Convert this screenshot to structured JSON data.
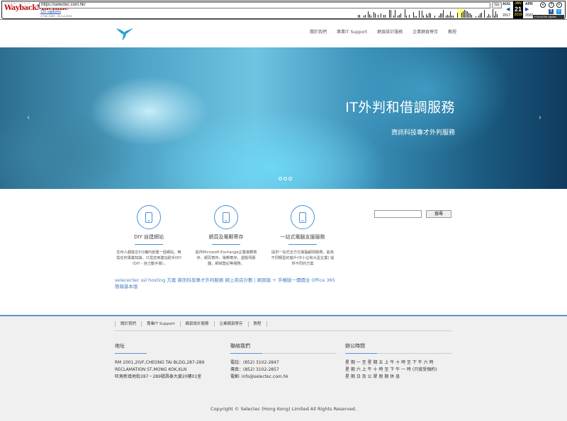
{
  "wayback": {
    "logo_top": "INTERNET ARCHIVE",
    "logo_main": "WaybackMachine",
    "url": "https://selectec.com.hk/",
    "go_label": "Go",
    "captures": "131 captures",
    "date_range": "2 Feb 2009 - 26 Jul 2024",
    "prev_month": "AUG",
    "cur_month": "JAN",
    "next_month": "APR",
    "prev_year": "2017",
    "cur_day": "21",
    "cur_year": "2019",
    "next_year": "2020",
    "about": "▾ About this capture"
  },
  "nav": {
    "items": [
      "關於我們",
      "專業IT Support",
      "網頁設計服務",
      "企業網頁寄存",
      "教程"
    ]
  },
  "hero": {
    "title": "IT外判和借調服務",
    "subtitle": "資訊科技專才外判服務",
    "prev": "‹",
    "next": "›"
  },
  "features": [
    {
      "title": "DIY 自建網站",
      "desc": "任何人都能在5分鐘內創建一個網站，無需任何專業知識，只需您用建站助手DIY（DIY - 自己動手做）。"
    },
    {
      "title": "網頁及電郵寄存",
      "desc": "提供Microsoft Exchange企業電郵寄存，網頁寄存，電郵寄存，虛擬伺服器，網域登記等服務。"
    },
    {
      "title": "一站式電腦支援服務",
      "desc": "提供一站式全方位電腦顧問服務，能為不同類型的客戶(中小企和大型企業) 提供不同的方案"
    }
  ],
  "tagline": "selecectec ssl hosting 方案 資訊科技專才外判服務 網上商店計劃 | 網頁版 + 手機版一價價全 Office 365 簡報基本版",
  "search": {
    "button": "搜尋",
    "placeholder": ""
  },
  "footer": {
    "nav": [
      "關於我們",
      "專業IT Support",
      "網頁設計服務",
      "企業網頁寄存",
      "教程"
    ],
    "address": {
      "title": "地址",
      "lines": [
        "RM 2001,20/F,CHEONG TAI BLDG,287-289",
        "RECLAMATION ST,MONG KOK,KLN",
        "旺角新填地街287－289號昌泰大廈20樓01室"
      ]
    },
    "contact": {
      "title": "聯絡我們",
      "lines": [
        "電話：(852) 3102-2847",
        "傳真：(852) 3102-2857",
        "電郵: info@selectec.com.hk"
      ]
    },
    "hours": {
      "title": "辦公時間",
      "lines": [
        "星 期 一 至 星 期 五 上 午 十 時 至 下 午 六 時",
        "星 期 六 上 午 十 時 至 下 午 一 時 (只接受預約)",
        "星 期 日 及 公 眾 假 期 休 息"
      ]
    },
    "copyright": "Copyright © Selectec (Hong Kong) Limited All Rights Reserved."
  },
  "colors": {
    "accent": "#4a90d9",
    "footer_border": "#5a95d0",
    "link": "#4a7dc7"
  }
}
